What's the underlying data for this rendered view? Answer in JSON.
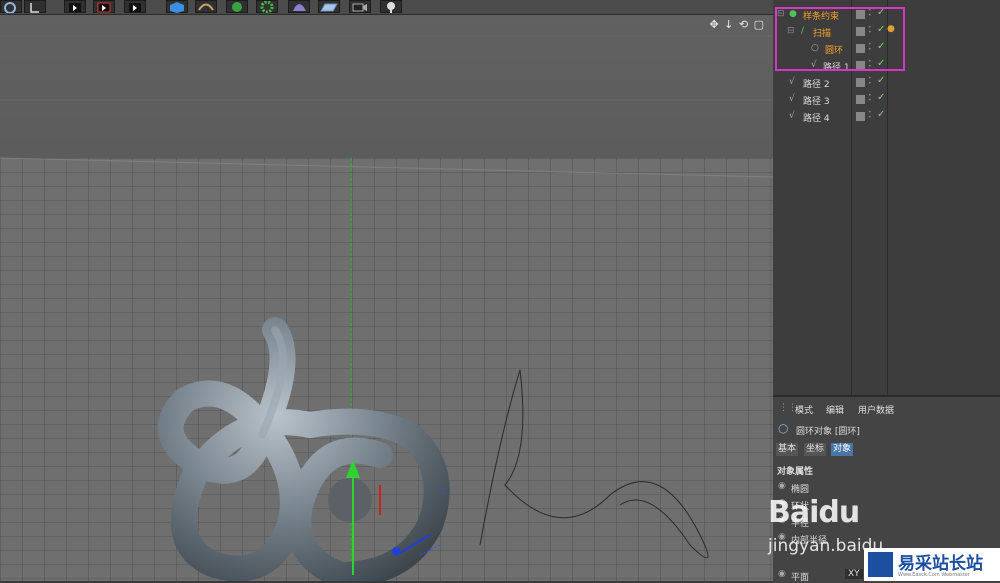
{
  "object_manager": {
    "rows": [
      {
        "name": "样条约束",
        "color": "orange"
      },
      {
        "name": "扫描",
        "color": "orange"
      },
      {
        "name": "圆环",
        "color": "orange"
      },
      {
        "name": "路径 1",
        "color": "white"
      },
      {
        "name": "路径 2",
        "color": "white"
      },
      {
        "name": "路径 3",
        "color": "white"
      },
      {
        "name": "路径 4",
        "color": "white"
      }
    ]
  },
  "attributes": {
    "menu": [
      "模式",
      "编辑",
      "用户数据"
    ],
    "object_title": "圆环对象 [圆环]",
    "tabs": [
      "基本",
      "坐标",
      "对象"
    ],
    "active_tab": "对象",
    "section": "对象属性",
    "fields": [
      "椭圆",
      "环状",
      "半径",
      "内部半径",
      "平面"
    ],
    "plane_value": "XY"
  },
  "watermark": {
    "baidu": "Baidu",
    "jingyan": "jingyan.baidu",
    "site_cn": "易采站长站",
    "site_en": "Www.Easck.Com  Webmaster"
  },
  "colors": {
    "highlight": "#d736c6",
    "orange": "#f3a12c",
    "accent": "#4976a8",
    "check": "#7ed36b"
  }
}
